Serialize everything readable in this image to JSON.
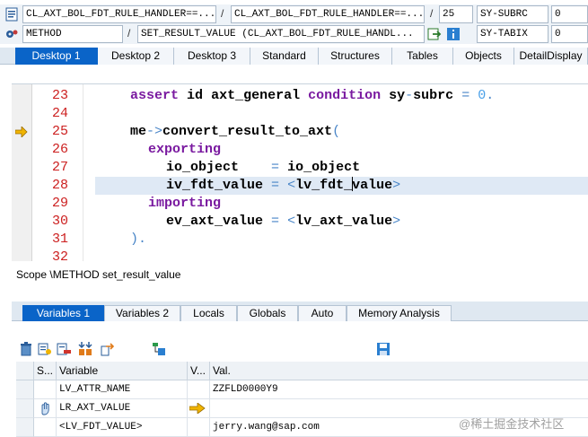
{
  "header": {
    "program_field": "CL_AXT_BOL_FDT_RULE_HANDLER==...",
    "include_field": "CL_AXT_BOL_FDT_RULE_HANDLER==...",
    "line_field": "25",
    "sysvar1_name": "SY-SUBRC",
    "sysvar1_value": "0",
    "event_type_field": "METHOD",
    "event_field": "SET_RESULT_VALUE (CL_AXT_BOL_FDT_RULE_HANDL...",
    "sysvar2_name": "SY-TABIX",
    "sysvar2_value": "0",
    "separator": "/"
  },
  "desktop_tabs": [
    {
      "label": "Desktop 1",
      "active": true
    },
    {
      "label": "Desktop 2",
      "active": false
    },
    {
      "label": "Desktop 3",
      "active": false
    },
    {
      "label": "Standard",
      "active": false
    },
    {
      "label": "Structures",
      "active": false
    },
    {
      "label": "Tables",
      "active": false
    },
    {
      "label": "Objects",
      "active": false
    },
    {
      "label": "DetailDisplay",
      "active": false
    }
  ],
  "editor": {
    "current_line": "25",
    "highlighted_line": "28",
    "lines": [
      {
        "no": "23",
        "kw1": "assert",
        "t1": " ",
        "b1": "id",
        "t2": " ",
        "b2": "axt_general",
        "t3": " ",
        "kw2": "condition",
        "t4": " ",
        "b3": "sy",
        "op1": "-",
        "b4": "subrc",
        "t5": " ",
        "op2": "=",
        "t6": " ",
        "num": "0",
        "op3": "."
      },
      {
        "no": "24"
      },
      {
        "no": "25",
        "b1": "me",
        "op1": "->",
        "b2": "convert_result_to_axt",
        "op2": "("
      },
      {
        "no": "26",
        "kw1": "exporting"
      },
      {
        "no": "27",
        "b1": "io_object",
        "t1": "    ",
        "op1": "=",
        "t2": " ",
        "b2": "io_object"
      },
      {
        "no": "28",
        "b1": "iv_fdt_value",
        "t1": " ",
        "op1": "=",
        "t2": " ",
        "op2": "<",
        "b2": "lv_fdt_",
        "b3": "value",
        "op3": ">"
      },
      {
        "no": "29",
        "kw1": "importing"
      },
      {
        "no": "30",
        "b1": "ev_axt_value",
        "t1": " ",
        "op1": "=",
        "t2": " ",
        "op2": "<",
        "b2": "lv_axt_value",
        "op3": ">"
      },
      {
        "no": "31",
        "op1": ").",
        "op2": ""
      },
      {
        "no": "32"
      }
    ]
  },
  "scope": "Scope \\METHOD set_result_value",
  "variable_tabs": [
    {
      "label": "Variables 1",
      "active": true
    },
    {
      "label": "Variables 2",
      "active": false
    },
    {
      "label": "Locals",
      "active": false
    },
    {
      "label": "Globals",
      "active": false
    },
    {
      "label": "Auto",
      "active": false
    },
    {
      "label": "Memory Analysis",
      "active": false
    }
  ],
  "toolbar_icons": [
    "delete-icon",
    "detail-icon",
    "delete-row-icon",
    "import-icon",
    "export-icon",
    "tree-icon",
    "save-icon"
  ],
  "grid": {
    "columns": [
      "S...",
      "Variable",
      "V...",
      "Val."
    ],
    "rows": [
      {
        "variable": "LV_ATTR_NAME",
        "value": "ZZFLD0000Y9",
        "icon": ""
      },
      {
        "variable": "LR_AXT_VALUE",
        "value": "",
        "icon": "pointer-arrow"
      },
      {
        "variable": "<LV_FDT_VALUE>",
        "value": "jerry.wang@sap.com",
        "icon": ""
      }
    ]
  },
  "watermark": "@稀土掘金技术社区",
  "colors": {
    "accent": "#0a64c8",
    "keyword": "#7a1aa0",
    "line_number": "#cc1f1f",
    "operator": "#4a86c8",
    "highlight": "#dfe9f5"
  }
}
